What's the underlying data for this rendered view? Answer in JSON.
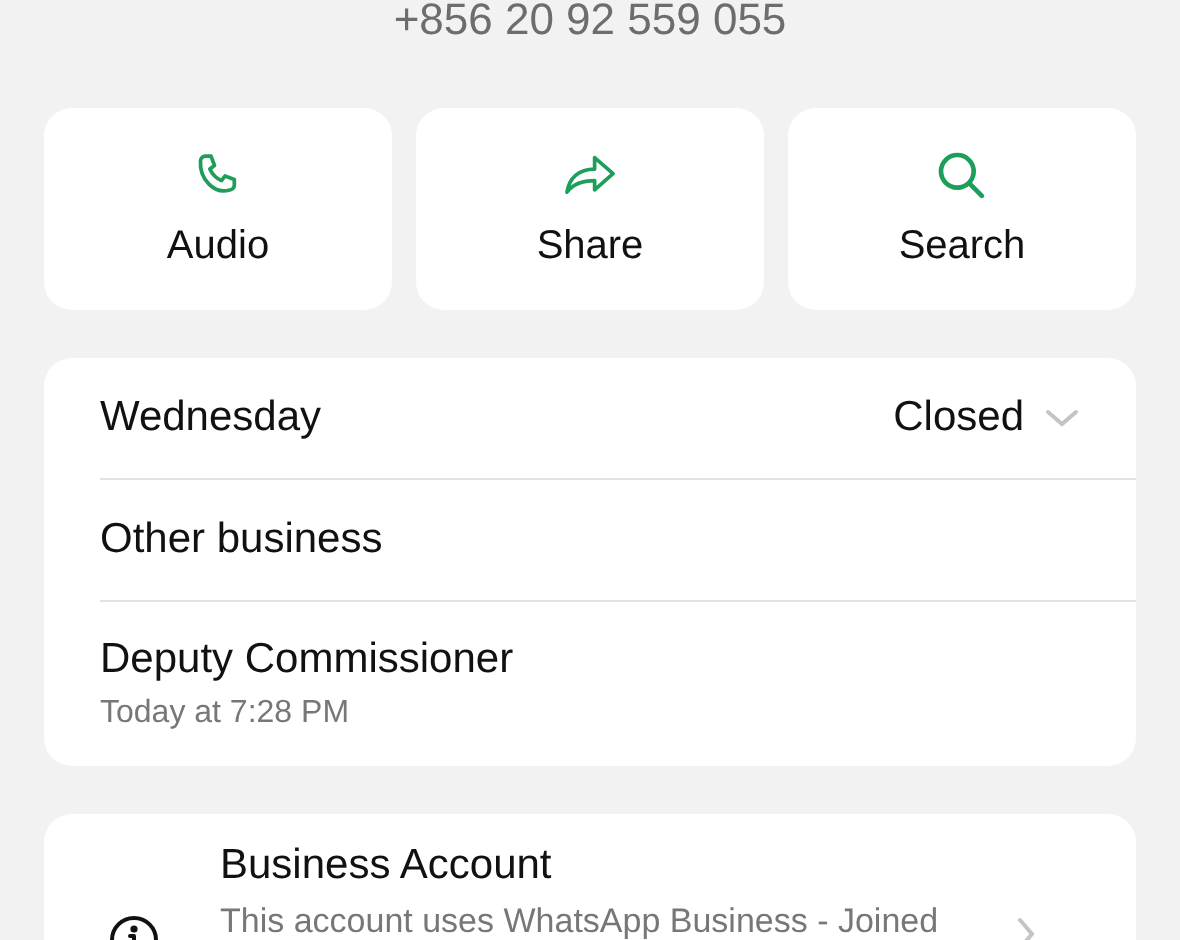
{
  "phone": "+856 20 92 559 055",
  "actions": [
    {
      "label": "Audio",
      "kind": "phone"
    },
    {
      "label": "Share",
      "kind": "share"
    },
    {
      "label": "Search",
      "kind": "search"
    }
  ],
  "info_rows": [
    {
      "kind": "hours",
      "title": "Wednesday",
      "value": "Closed"
    },
    {
      "kind": "plain",
      "title": "Other business"
    },
    {
      "kind": "subtitled",
      "title": "Deputy Commissioner",
      "subtitle": "Today at 7:28 PM"
    }
  ],
  "business_account": {
    "title": "Business Account",
    "subtitle": "This account uses WhatsApp Business - Joined"
  }
}
